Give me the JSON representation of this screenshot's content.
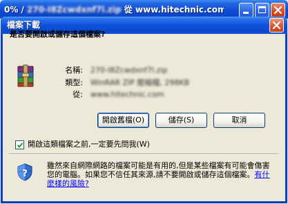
{
  "outer_window": {
    "title_prefix": "0% /",
    "title_blurred": "270-I8Zcwdxnf7l.zip",
    "title_suffix": "從 www.hitechnic.com 已完成"
  },
  "dialog": {
    "title": "檔案下載",
    "question": "是否要開啟或儲存這個檔案?",
    "file_info": {
      "name_label": "名稱:",
      "name_value": "270-I8Zcwdxnf7l.zip",
      "type_label": "類型:",
      "type_value": "WinRAR ZIP 壓縮檔, 298KB",
      "from_label": "從:",
      "from_value": "www.hitechnic.com"
    },
    "buttons": {
      "open": "開啟舊檔(O)",
      "save": "儲存(S)",
      "cancel": "取消"
    },
    "checkbox": {
      "label": "開啟這類檔案之前,一定要先問我(W)",
      "checked": true
    },
    "warning": {
      "text": "雖然來自網際網路的檔案可能是有用的,但是某些檔案有可能會傷害您的電腦。如果您不信任其來源,請不要開啟或儲存這個檔案。",
      "link": "有什麼樣的風險?"
    }
  },
  "colors": {
    "titlebar_blue": "#0b46c6",
    "window_bg": "#ece9d8",
    "close_red": "#d8512b",
    "link": "#0000ff"
  },
  "icons": [
    "winrar-archive-icon",
    "security-shield-icon",
    "close-icon",
    "minimize-icon",
    "maximize-icon",
    "checkmark-icon"
  ]
}
